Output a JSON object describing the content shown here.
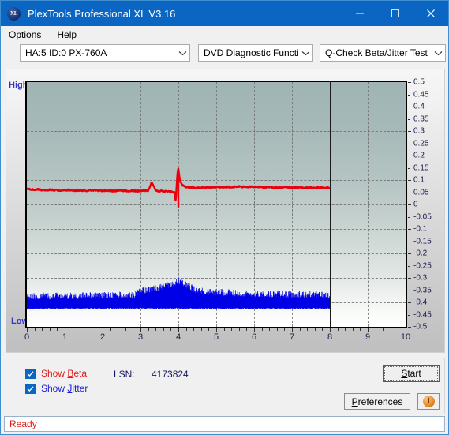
{
  "window": {
    "title": "PlexTools Professional XL V3.16",
    "icon": "app-xl-badge-icon",
    "minimize_icon": "minimize-icon",
    "maximize_icon": "maximize-icon",
    "close_icon": "close-icon",
    "titlebar_color": "#0a66c2"
  },
  "menu": {
    "items": [
      {
        "label": "Options",
        "accel": "O"
      },
      {
        "label": "Help",
        "accel": "H"
      }
    ]
  },
  "toolbar": {
    "drive_combo": {
      "value": "HA:5 ID:0  PX-760A"
    },
    "function_combo": {
      "value": "DVD Diagnostic Functions"
    },
    "test_combo": {
      "value": "Q-Check Beta/Jitter Test"
    },
    "dropdown_icon": "chevron-down-icon"
  },
  "chart_data": {
    "type": "line",
    "title": "",
    "xlabel": "",
    "ylabel": "",
    "xlim": [
      0,
      10
    ],
    "ylim": [
      -0.5,
      0.5
    ],
    "grid": true,
    "legend_position": "bottom-left",
    "axis_end_marker_x": 8,
    "left_axis_labels": {
      "top": "High",
      "bottom": "Low"
    },
    "x_ticks": [
      0,
      1,
      2,
      3,
      4,
      5,
      6,
      7,
      8,
      9,
      10
    ],
    "y_ticks": [
      0.5,
      0.45,
      0.4,
      0.35,
      0.3,
      0.25,
      0.2,
      0.15,
      0.1,
      0.05,
      0,
      -0.05,
      -0.1,
      -0.15,
      -0.2,
      -0.25,
      -0.3,
      -0.35,
      -0.4,
      -0.45,
      -0.5
    ],
    "y_tick_labels": [
      "0.5",
      "0.45",
      "0.4",
      "0.35",
      "0.3",
      "0.25",
      "0.2",
      "0.15",
      "0.1",
      "0.05",
      "0",
      "-0.05",
      "-0.1",
      "-0.15",
      "-0.2",
      "-0.25",
      "-0.3",
      "-0.35",
      "-0.4",
      "-0.45",
      "-0.5"
    ],
    "series": [
      {
        "name": "Show Beta",
        "color": "#e8000d",
        "x": [
          0.0,
          0.1,
          0.2,
          0.3,
          0.4,
          0.5,
          0.6,
          0.7,
          0.8,
          0.9,
          1.0,
          1.1,
          1.2,
          1.3,
          1.4,
          1.5,
          1.6,
          1.7,
          1.8,
          1.9,
          2.0,
          2.1,
          2.2,
          2.3,
          2.4,
          2.5,
          2.6,
          2.7,
          2.8,
          2.9,
          3.0,
          3.1,
          3.2,
          3.3,
          3.4,
          3.45,
          3.5,
          3.6,
          3.7,
          3.8,
          3.85,
          3.9,
          3.93,
          3.96,
          3.98,
          4.0,
          4.02,
          4.05,
          4.1,
          4.15,
          4.2,
          4.3,
          4.4,
          4.5,
          4.6,
          4.7,
          4.8,
          4.9,
          5.0,
          5.1,
          5.2,
          5.3,
          5.4,
          5.5,
          5.6,
          5.7,
          5.8,
          5.9,
          6.0,
          6.1,
          6.2,
          6.3,
          6.4,
          6.5,
          6.6,
          6.7,
          6.8,
          6.9,
          7.0,
          7.1,
          7.2,
          7.3,
          7.4,
          7.5,
          7.6,
          7.7,
          7.8,
          7.9,
          8.0
        ],
        "y": [
          0.063,
          0.062,
          0.06,
          0.061,
          0.059,
          0.058,
          0.06,
          0.059,
          0.058,
          0.057,
          0.058,
          0.059,
          0.058,
          0.057,
          0.058,
          0.057,
          0.056,
          0.057,
          0.058,
          0.057,
          0.056,
          0.057,
          0.056,
          0.055,
          0.056,
          0.057,
          0.056,
          0.055,
          0.056,
          0.055,
          0.056,
          0.057,
          0.056,
          0.09,
          0.058,
          0.056,
          0.055,
          0.054,
          0.053,
          0.052,
          0.05,
          0.048,
          0.01,
          0.09,
          0.13,
          0.148,
          0.12,
          0.095,
          0.08,
          0.074,
          0.072,
          0.07,
          0.069,
          0.068,
          0.069,
          0.07,
          0.069,
          0.07,
          0.071,
          0.07,
          0.071,
          0.072,
          0.071,
          0.072,
          0.073,
          0.072,
          0.071,
          0.072,
          0.073,
          0.072,
          0.071,
          0.07,
          0.071,
          0.07,
          0.069,
          0.07,
          0.071,
          0.07,
          0.069,
          0.07,
          0.069,
          0.068,
          0.069,
          0.068,
          0.069,
          0.068,
          0.069,
          0.068,
          0.069
        ],
        "noise": 0.006,
        "spike": {
          "x": 4.0,
          "peak_y": 0.148,
          "min_y": -0.012
        }
      },
      {
        "name": "Show Jitter",
        "color": "#0000e6",
        "x": [
          0.0,
          0.2,
          0.4,
          0.6,
          0.8,
          1.0,
          1.2,
          1.4,
          1.6,
          1.8,
          2.0,
          2.2,
          2.4,
          2.6,
          2.8,
          3.0,
          3.2,
          3.4,
          3.6,
          3.8,
          4.0,
          4.1,
          4.2,
          4.3,
          4.4,
          4.5,
          4.6,
          4.8,
          5.0,
          5.2,
          5.4,
          5.6,
          5.8,
          6.0,
          6.2,
          6.4,
          6.6,
          6.8,
          7.0,
          7.2,
          7.4,
          7.6,
          7.8,
          8.0
        ],
        "y": [
          -0.4,
          -0.402,
          -0.398,
          -0.401,
          -0.399,
          -0.397,
          -0.4,
          -0.398,
          -0.396,
          -0.399,
          -0.397,
          -0.398,
          -0.396,
          -0.398,
          -0.397,
          -0.38,
          -0.372,
          -0.368,
          -0.362,
          -0.352,
          -0.338,
          -0.345,
          -0.355,
          -0.362,
          -0.37,
          -0.375,
          -0.378,
          -0.382,
          -0.385,
          -0.386,
          -0.387,
          -0.388,
          -0.389,
          -0.39,
          -0.39,
          -0.391,
          -0.392,
          -0.392,
          -0.393,
          -0.394,
          -0.393,
          -0.392,
          -0.393,
          -0.394
        ],
        "band_low": -0.425,
        "style": "noise-band"
      }
    ]
  },
  "controls": {
    "show_beta": {
      "label_pre": "Show ",
      "label_accel": "B",
      "label_post": "eta",
      "checked": true
    },
    "show_jitter": {
      "label_pre": "Show ",
      "label_accel": "J",
      "label_post": "itter",
      "checked": true
    },
    "lsn_label": "LSN:",
    "lsn_value": "4173824",
    "start_button": {
      "label_pre": "",
      "label_accel": "S",
      "label_post": "tart"
    },
    "preferences_button": {
      "label_pre": "",
      "label_accel": "P",
      "label_post": "references"
    },
    "info_button": {
      "icon": "info-icon",
      "glyph": "i"
    }
  },
  "status": {
    "text": "Ready",
    "color": "#e01b1b"
  }
}
